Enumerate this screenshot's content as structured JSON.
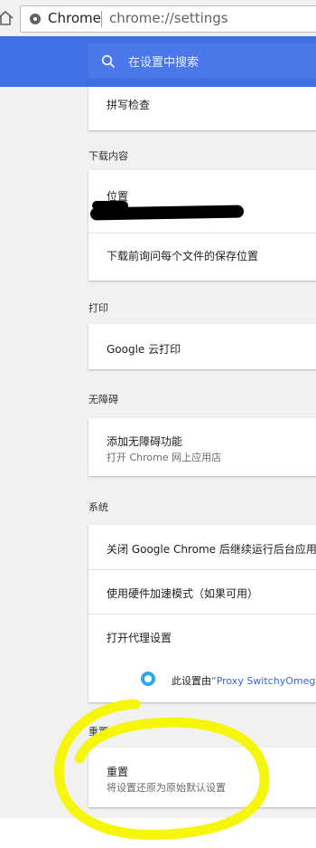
{
  "browser": {
    "brand": "Chrome",
    "url": "chrome://settings"
  },
  "search": {
    "placeholder": "在设置中搜索"
  },
  "spellcheck": {
    "label": "拼写检查"
  },
  "downloads": {
    "section": "下载内容",
    "location_label": "位置",
    "ask_label": "下载前询问每个文件的保存位置"
  },
  "print": {
    "section": "打印",
    "cloud_print": "Google 云打印"
  },
  "accessibility": {
    "section": "无障碍",
    "add_label": "添加无障碍功能",
    "add_sub": "打开 Chrome 网上应用店"
  },
  "system": {
    "section": "系统",
    "background_apps": "关闭 Google Chrome 后继续运行后台应用",
    "hw_accel": "使用硬件加速模式（如果可用）",
    "proxy": "打开代理设置",
    "proxy_note_prefix": "此设置由",
    "proxy_note_link": "“Proxy SwitchyOmega"
  },
  "reset": {
    "section": "重置",
    "label": "重置",
    "sub": "将设置还原为原始默认设置"
  },
  "colors": {
    "header": "#3f6fe0",
    "accent": "#2ba8f0",
    "highlight": "#f5f500"
  }
}
